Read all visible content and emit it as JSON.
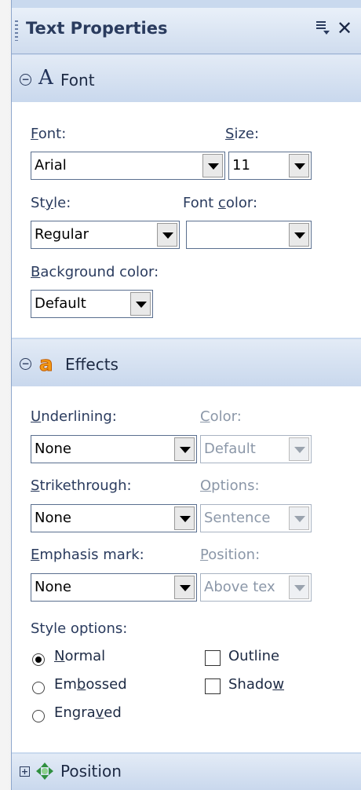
{
  "pane": {
    "title": "Text Properties"
  },
  "font_section": {
    "title": "Font",
    "font_label_u": "F",
    "font_label_rest": "ont:",
    "font_value": "Arial",
    "size_label_u": "S",
    "size_label_rest": "ize:",
    "size_value": "11",
    "style_label_a": "St",
    "style_label_u": "y",
    "style_label_b": "le:",
    "style_value": "Regular",
    "font_color_label_a": "Font ",
    "font_color_label_u": "c",
    "font_color_label_b": "olor:",
    "font_color_value": "",
    "bg_color_label_u": "B",
    "bg_color_label_rest": "ackground color:",
    "bg_color_value": "Default"
  },
  "effects_section": {
    "title": "Effects",
    "underlining_label_u": "U",
    "underlining_label_rest": "nderlining:",
    "underlining_value": "None",
    "color_label_u": "C",
    "color_label_rest": "olor:",
    "color_value": "Default",
    "strikethrough_label_u": "S",
    "strikethrough_label_rest": "trikethrough:",
    "strikethrough_value": "None",
    "options_label_u": "O",
    "options_label_rest": "ptions:",
    "options_value": "Sentence",
    "emphasis_label_u": "E",
    "emphasis_label_rest": "mphasis mark:",
    "emphasis_value": "None",
    "position_label_u": "P",
    "position_label_rest": "osition:",
    "position_value": "Above tex",
    "style_options_label": "Style options:",
    "normal_u": "N",
    "normal_rest": "ormal",
    "embossed_a": "Em",
    "embossed_u": "b",
    "embossed_b": "ossed",
    "engraved_a": "Engra",
    "engraved_u": "v",
    "engraved_b": "ed",
    "outline_label": "Outline",
    "shadow_a": "Shado",
    "shadow_u": "w"
  },
  "position_section": {
    "title": "Position"
  }
}
